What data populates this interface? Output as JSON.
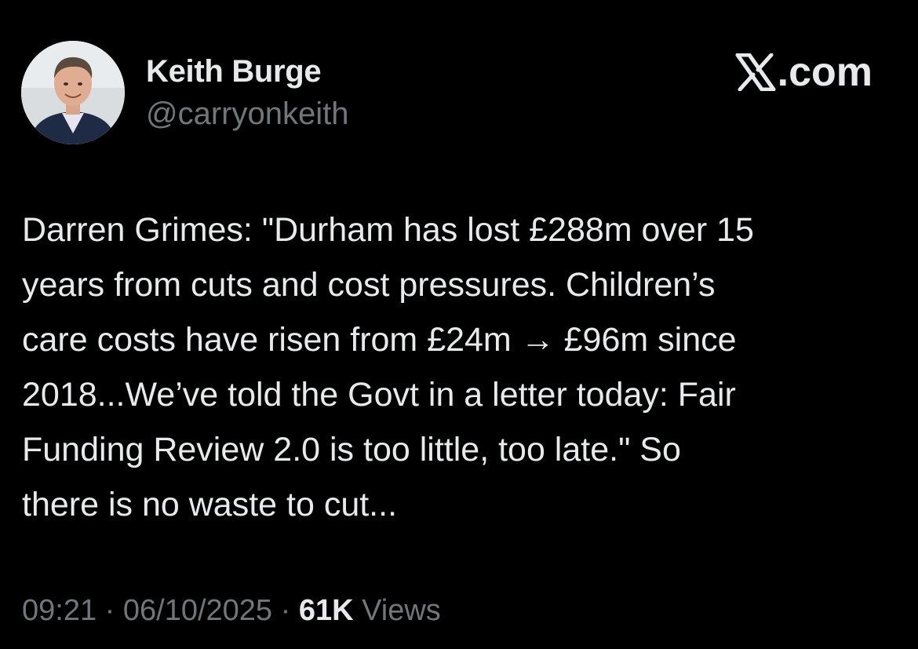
{
  "author": {
    "display_name": "Keith Burge",
    "handle": "@carryonkeith"
  },
  "brand": {
    "icon": "x-logo-icon",
    "label": ".com"
  },
  "tweet": {
    "text": "Darren Grimes: \"Durham has lost £288m over 15\nyears from cuts and cost pressures. Children’s\ncare costs have risen from £24m → £96m since\n2018...We’ve told the Govt in a letter today: Fair\nFunding Review 2.0 is too little, too late.\" So\nthere is no waste to cut..."
  },
  "meta": {
    "time": "09:21",
    "separator": " · ",
    "date": "06/10/2025",
    "views_count": "61K",
    "views_label": " Views"
  },
  "colors": {
    "background": "#000000",
    "primary_text": "#e7e9ea",
    "secondary_text": "#71767b"
  }
}
